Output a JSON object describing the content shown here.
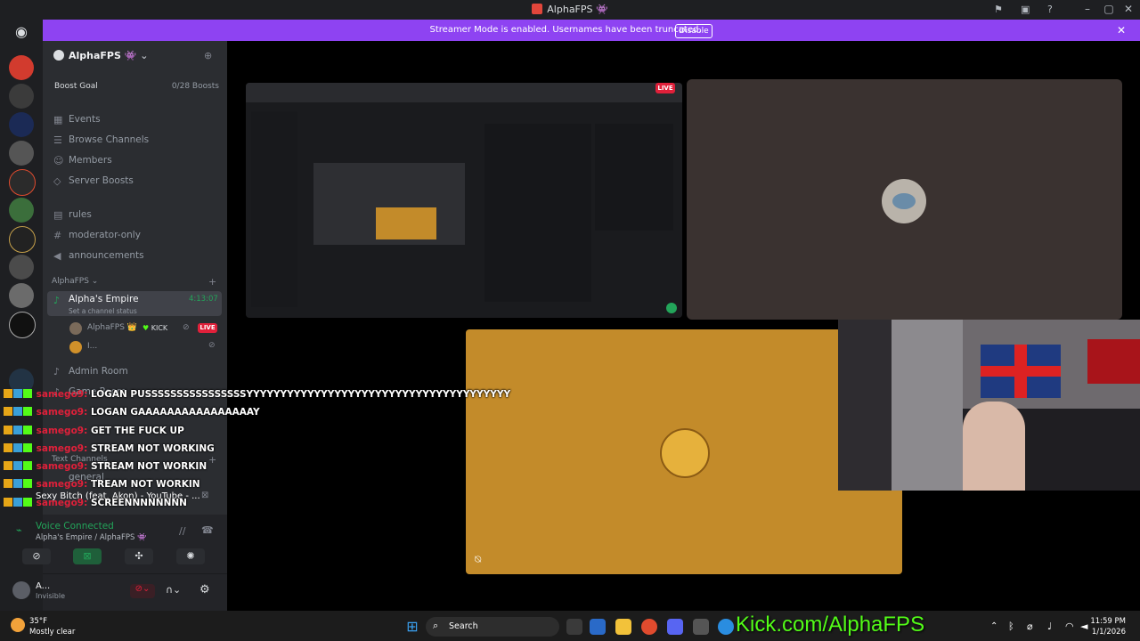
{
  "window": {
    "title": "AlphaFPS 👾"
  },
  "banner": {
    "text": "Streamer Mode is enabled. Usernames have been truncated.",
    "button": "Disable"
  },
  "server": {
    "name": "AlphaFPS 👾",
    "boost_goal": "Boost Goal",
    "boost_count": "0/28 Boosts",
    "menu": [
      "Events",
      "Browse Channels",
      "Members",
      "Server Boosts"
    ],
    "channels": [
      "rules",
      "moderator-only",
      "announcements"
    ],
    "category": "AlphaFPS",
    "voice_channel": {
      "name": "Alpha's Empire",
      "timer": "4:13:07",
      "status": "Set a channel status"
    },
    "voice_users": [
      {
        "name": "AlphaFPS 👑",
        "tag": "KICK",
        "live": "LIVE"
      },
      {
        "name": "I..."
      }
    ],
    "more_channels": [
      "Admin Room",
      "Game Room"
    ],
    "text_category": "Text Channels",
    "text_channel": "general"
  },
  "music_notification": "Sexy Bitch (feat. Akon) - YouTube - ...",
  "voice": {
    "status": "Voice Connected",
    "location": "Alpha's Empire / AlphaFPS 👾"
  },
  "user": {
    "name": "A...",
    "status": "Invisible"
  },
  "stage": {
    "live_badge": "LIVE"
  },
  "chat": [
    {
      "user": "samego9:",
      "msg": "LOGAN PUSSSSSSSSSSSSSSSSYYYYYYYYYYYYYYYYYYYYYYYYYYYYYYYYYYYYYYY"
    },
    {
      "user": "samego9:",
      "msg": "LOGAN GAAAAAAAAAAAAAAAAY"
    },
    {
      "user": "samego9:",
      "msg": "GET THE FUCK UP"
    },
    {
      "user": "samego9:",
      "msg": "STREAM NOT WORKING"
    },
    {
      "user": "samego9:",
      "msg": "STREAM NOT WORKIN"
    },
    {
      "user": "samego9:",
      "msg": "TREAM NOT WORKIN"
    },
    {
      "user": "samego9:",
      "msg": "SCREENNNNNNNN"
    }
  ],
  "taskbar": {
    "weather_temp": "35°F",
    "weather_desc": "Mostly clear",
    "search": "Search",
    "time": "11:59 PM",
    "date": "1/1/2026"
  },
  "overlay": {
    "kick_url": "Kick.com/AlphaFPS"
  },
  "colors": {
    "accent": "#8e43f2",
    "live": "#e0203a",
    "kick_green": "#53fc18",
    "voice_green": "#23a55a"
  }
}
